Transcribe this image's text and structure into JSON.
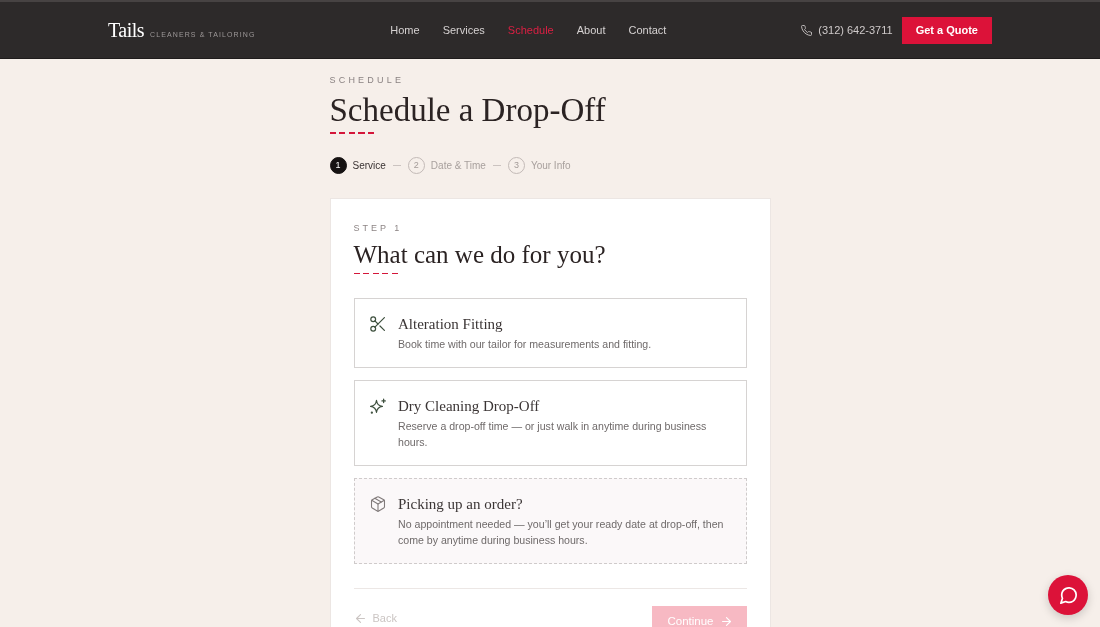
{
  "header": {
    "logo": "Tails",
    "tagline": "CLEANERS & TAILORING",
    "nav": [
      {
        "label": "Home",
        "selected": false
      },
      {
        "label": "Services",
        "selected": false
      },
      {
        "label": "Schedule",
        "selected": true
      },
      {
        "label": "About",
        "selected": false
      },
      {
        "label": "Contact",
        "selected": false
      }
    ],
    "phone": "(312) 642-3711",
    "cta": "Get a Quote"
  },
  "page": {
    "eyebrow": "SCHEDULE",
    "title": "Schedule a Drop-Off"
  },
  "steps": [
    {
      "number": "1",
      "label": "Service",
      "selected": true
    },
    {
      "number": "2",
      "label": "Date & Time",
      "selected": false
    },
    {
      "number": "3",
      "label": "Your Info",
      "selected": false
    }
  ],
  "card": {
    "step_label": "STEP 1",
    "heading": "What can we do for you?",
    "options": [
      {
        "kind": "fitting",
        "title": "Alteration Fitting",
        "description": "Book time with our tailor for measurements and fitting.",
        "selected": false
      },
      {
        "kind": "cleaning",
        "title": "Dry Cleaning Drop-Off",
        "description": "Reserve a drop-off time — or just walk in anytime during business hours.",
        "selected": false
      },
      {
        "kind": "pickup",
        "title": "Picking up an order?",
        "description": "No appointment needed — you’ll get your ready date at drop-off, then come by anytime during business hours."
      }
    ],
    "back": {
      "label": "Back",
      "disabled": true
    },
    "continue": {
      "label": "Continue",
      "disabled": true
    }
  }
}
